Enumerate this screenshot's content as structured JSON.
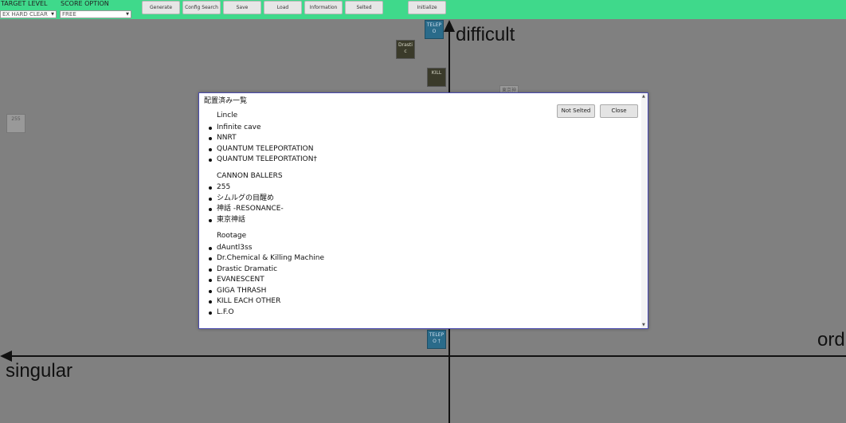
{
  "toolbar": {
    "target_level_label": "TARGET LEVEL",
    "target_level_value": "EX HARD CLEAR",
    "score_option_label": "SCORE OPTION",
    "score_option_value": "FREE",
    "buttons": {
      "generate": "Generate",
      "config_search": "Config Search",
      "save": "Save",
      "load": "Load",
      "information": "Information",
      "selted": "Selted",
      "initialize": "Initialize"
    },
    "colors": {
      "bar": "#3fd98b"
    }
  },
  "stage": {
    "axis_labels": {
      "top": "difficult",
      "left": "singular",
      "right": "ord"
    },
    "tiles": {
      "telep_top": "TELEP O",
      "drastic": "Drasti c",
      "kill": "KILL",
      "tokyo": "東京神",
      "t255": "255",
      "telep_bottom": "TELEP O †"
    }
  },
  "modal": {
    "title": "配置済み一覧",
    "not_selted_button": "Not Selted",
    "close_button": "Close",
    "groups": [
      {
        "name": "Lincle",
        "items": [
          "Infinite cave",
          "NNRT",
          "QUANTUM TELEPORTATION",
          "QUANTUM TELEPORTATION†"
        ]
      },
      {
        "name": "CANNON BALLERS",
        "items": [
          "255",
          "シムルグの目醒め",
          "神話 -RESONANCE-",
          "東京神話"
        ]
      },
      {
        "name": "Rootage",
        "items": [
          "dAuntl3ss",
          "Dr.Chemical & Killing Machine",
          "Drastic Dramatic",
          "EVANESCENT",
          "GIGA THRASH",
          "KILL EACH OTHER",
          "L.F.O"
        ]
      }
    ]
  }
}
